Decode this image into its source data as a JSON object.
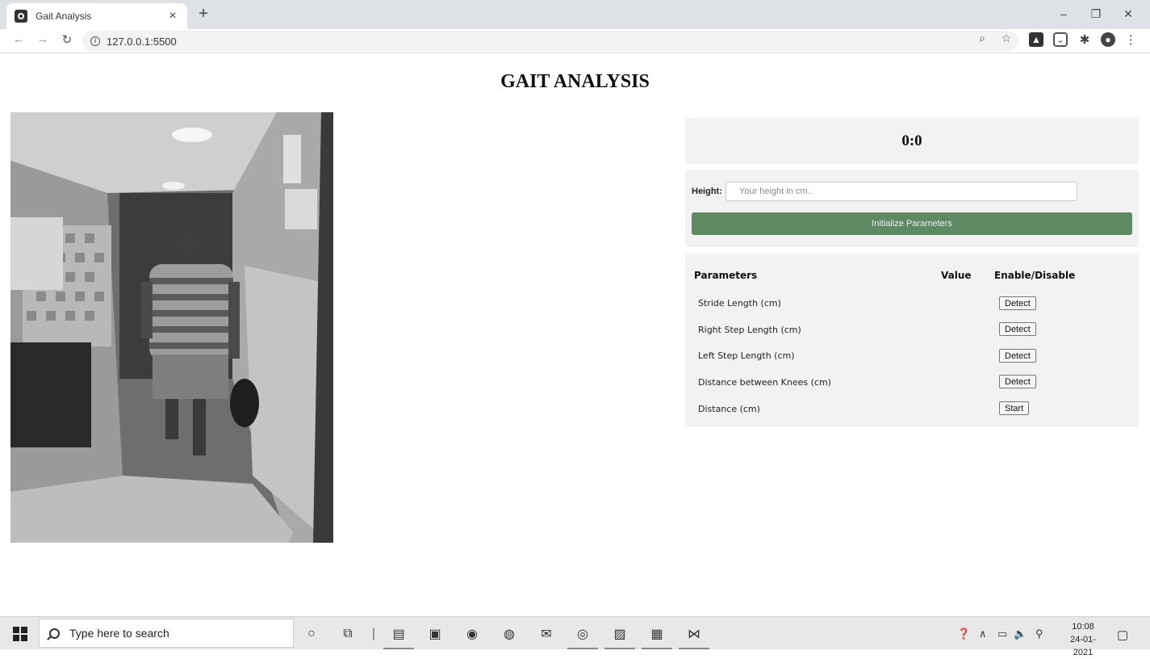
{
  "browser": {
    "tab_title": "Gait Analysis",
    "tab_close": "×",
    "new_tab": "+",
    "url": "127.0.0.1:5500",
    "window_controls": {
      "minimize": "–",
      "maximize": "❐",
      "close": "✕"
    }
  },
  "page": {
    "title": "GAIT ANALYSIS",
    "score": "0:0",
    "height_label": "Height:",
    "height_placeholder": "Your height in cm..",
    "initialize_button": "Initialize Parameters",
    "table": {
      "headers": {
        "parameters": "Parameters",
        "value": "Value",
        "toggle": "Enable/Disable"
      },
      "rows": [
        {
          "label": "Stride Length (cm)",
          "value": "",
          "button": "Detect"
        },
        {
          "label": "Right Step Length (cm)",
          "value": "",
          "button": "Detect"
        },
        {
          "label": "Left Step Length (cm)",
          "value": "",
          "button": "Detect"
        },
        {
          "label": "Distance between Knees (cm)",
          "value": "",
          "button": "Detect"
        },
        {
          "label": "Distance (cm)",
          "value": "",
          "button": "Start"
        }
      ]
    }
  },
  "taskbar": {
    "search_placeholder": "Type here to search",
    "time": "10:08",
    "date": "24-01-2021"
  },
  "colors": {
    "accent_button": "#5e8a63",
    "panel_bg": "#f2f2f2",
    "tabbar_bg": "#dee1e6"
  }
}
